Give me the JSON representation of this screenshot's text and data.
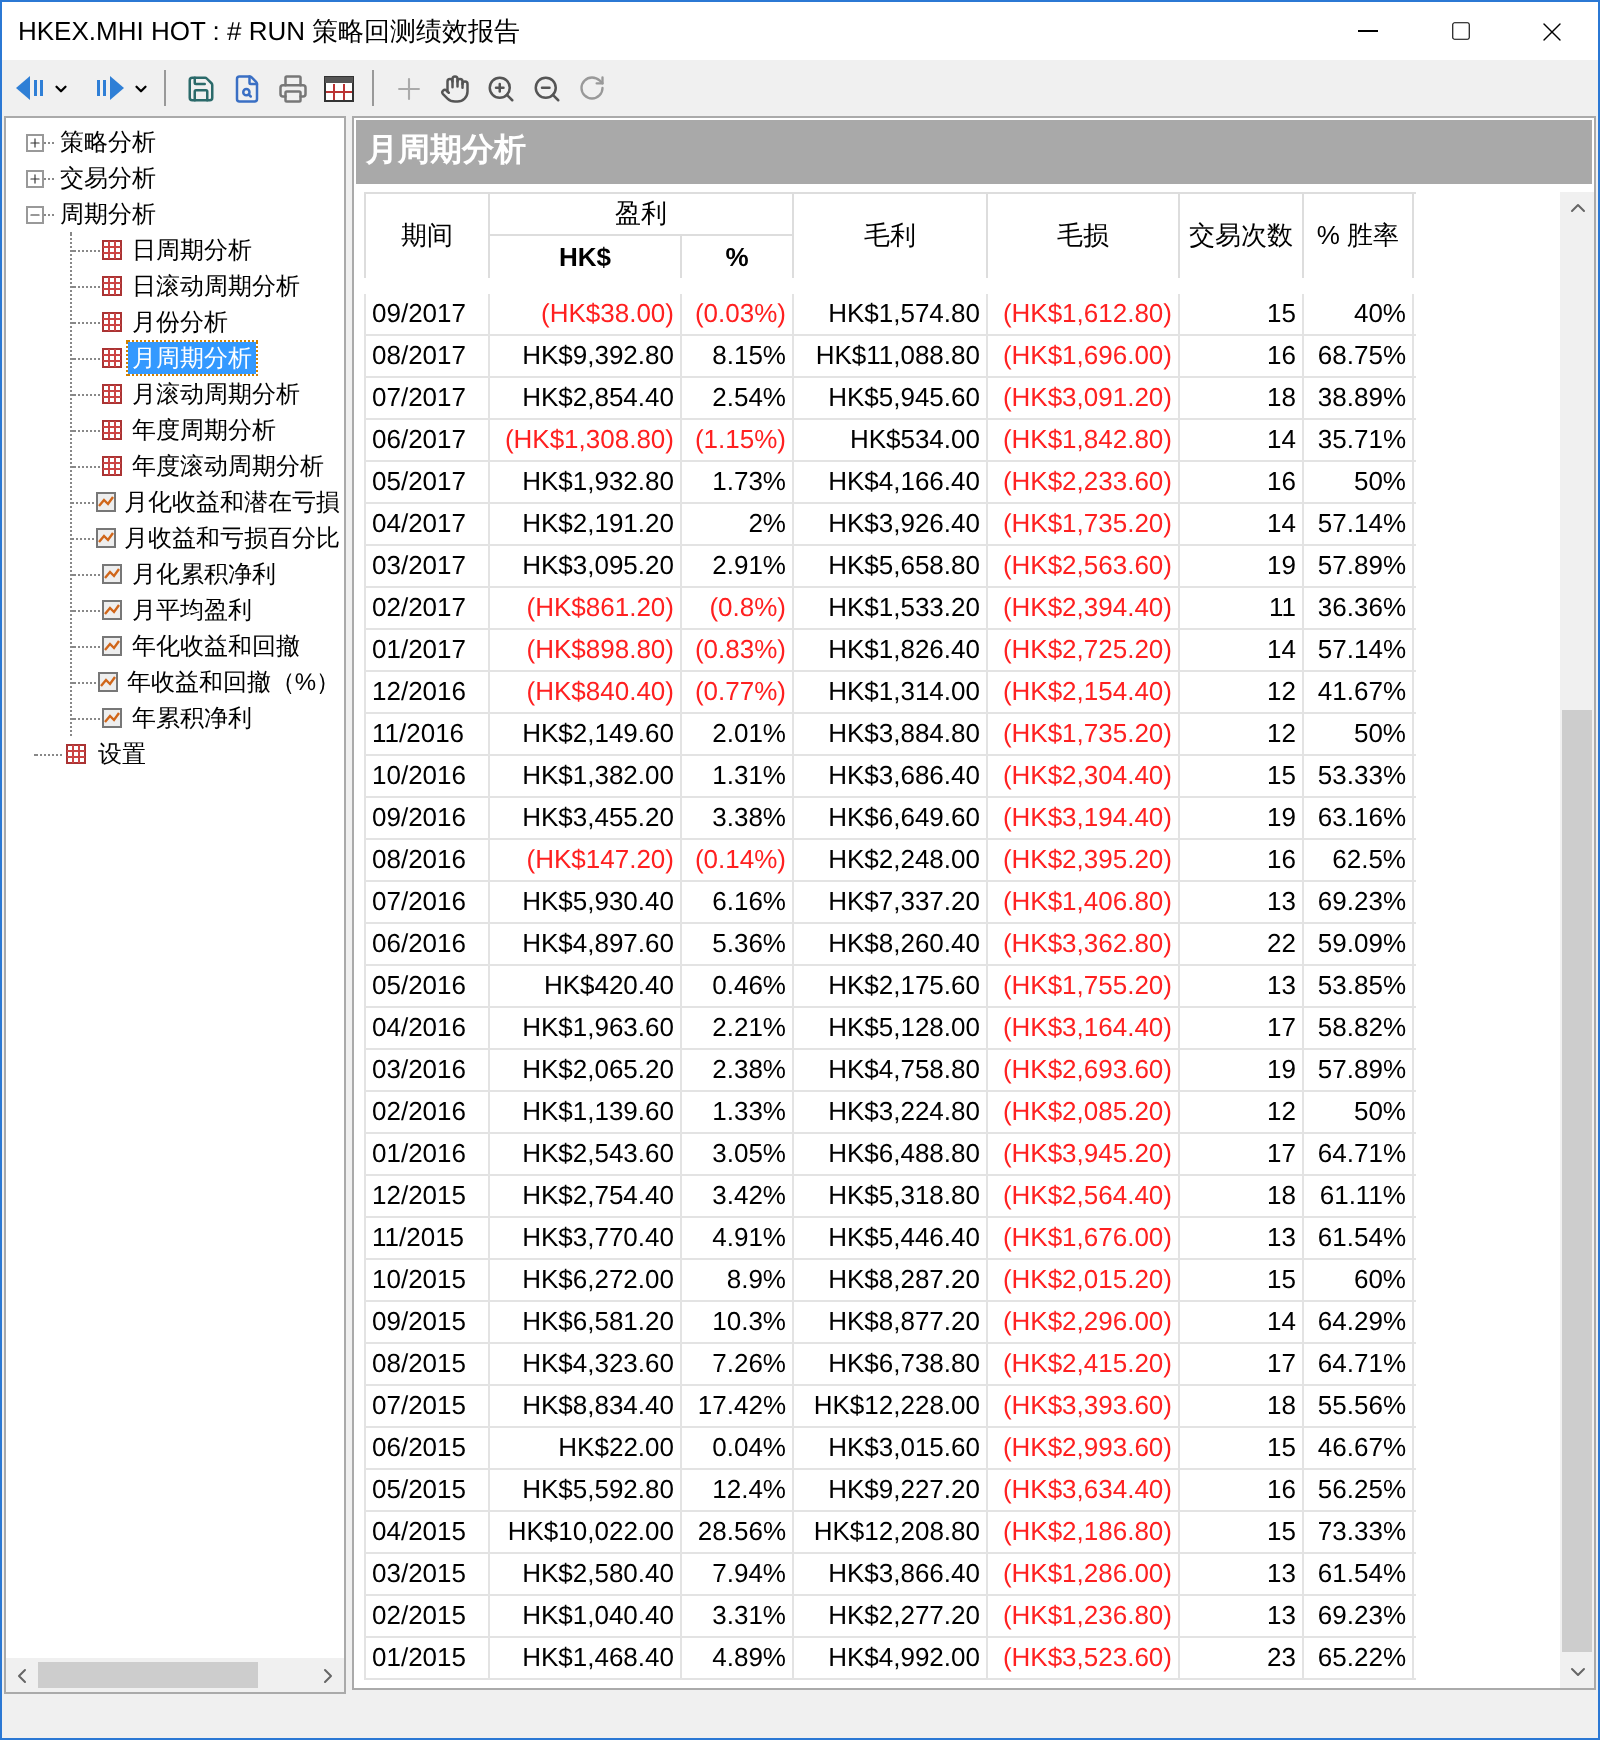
{
  "window": {
    "title": "HKEX.MHI HOT : # RUN 策略回测绩效报告"
  },
  "tree": [
    {
      "label": "策略分析",
      "kind": "folder",
      "expanded": false,
      "selected": false
    },
    {
      "label": "交易分析",
      "kind": "folder",
      "expanded": false,
      "selected": false
    },
    {
      "label": "周期分析",
      "kind": "folder",
      "expanded": true,
      "selected": false,
      "children": [
        {
          "label": "日周期分析",
          "kind": "grid",
          "selected": false
        },
        {
          "label": "日滚动周期分析",
          "kind": "grid",
          "selected": false
        },
        {
          "label": "月份分析",
          "kind": "grid",
          "selected": false
        },
        {
          "label": "月周期分析",
          "kind": "grid",
          "selected": true
        },
        {
          "label": "月滚动周期分析",
          "kind": "grid",
          "selected": false
        },
        {
          "label": "年度周期分析",
          "kind": "grid",
          "selected": false
        },
        {
          "label": "年度滚动周期分析",
          "kind": "grid",
          "selected": false
        },
        {
          "label": "月化收益和潜在亏損",
          "kind": "chart",
          "selected": false
        },
        {
          "label": "月收益和亏损百分比",
          "kind": "chart",
          "selected": false
        },
        {
          "label": "月化累积净利",
          "kind": "chart",
          "selected": false
        },
        {
          "label": "月平均盈利",
          "kind": "chart",
          "selected": false
        },
        {
          "label": "年化收益和回撤",
          "kind": "chart",
          "selected": false
        },
        {
          "label": "年收益和回撤（%）",
          "kind": "chart",
          "selected": false
        },
        {
          "label": "年累积净利",
          "kind": "chart",
          "selected": false
        }
      ]
    },
    {
      "label": "设置",
      "kind": "grid",
      "selected": false
    }
  ],
  "panel": {
    "title": "月周期分析"
  },
  "table": {
    "column_groups": [
      {
        "label": "盈利"
      }
    ],
    "columns": [
      {
        "label": "期间"
      },
      {
        "label": "HK$"
      },
      {
        "label": "%"
      },
      {
        "label": "毛利"
      },
      {
        "label": "毛损"
      },
      {
        "label": "交易次数"
      },
      {
        "label": "% 胜率"
      }
    ],
    "rows": [
      {
        "negative": true,
        "cells": [
          "09/2017",
          "(HK$38.00)",
          "(0.03%)",
          "HK$1,574.80",
          "(HK$1,612.80)",
          "15",
          "40%"
        ]
      },
      {
        "negative": false,
        "cells": [
          "08/2017",
          "HK$9,392.80",
          "8.15%",
          "HK$11,088.80",
          "(HK$1,696.00)",
          "16",
          "68.75%"
        ]
      },
      {
        "negative": false,
        "cells": [
          "07/2017",
          "HK$2,854.40",
          "2.54%",
          "HK$5,945.60",
          "(HK$3,091.20)",
          "18",
          "38.89%"
        ]
      },
      {
        "negative": true,
        "cells": [
          "06/2017",
          "(HK$1,308.80)",
          "(1.15%)",
          "HK$534.00",
          "(HK$1,842.80)",
          "14",
          "35.71%"
        ]
      },
      {
        "negative": false,
        "cells": [
          "05/2017",
          "HK$1,932.80",
          "1.73%",
          "HK$4,166.40",
          "(HK$2,233.60)",
          "16",
          "50%"
        ]
      },
      {
        "negative": false,
        "cells": [
          "04/2017",
          "HK$2,191.20",
          "2%",
          "HK$3,926.40",
          "(HK$1,735.20)",
          "14",
          "57.14%"
        ]
      },
      {
        "negative": false,
        "cells": [
          "03/2017",
          "HK$3,095.20",
          "2.91%",
          "HK$5,658.80",
          "(HK$2,563.60)",
          "19",
          "57.89%"
        ]
      },
      {
        "negative": true,
        "cells": [
          "02/2017",
          "(HK$861.20)",
          "(0.8%)",
          "HK$1,533.20",
          "(HK$2,394.40)",
          "11",
          "36.36%"
        ]
      },
      {
        "negative": true,
        "cells": [
          "01/2017",
          "(HK$898.80)",
          "(0.83%)",
          "HK$1,826.40",
          "(HK$2,725.20)",
          "14",
          "57.14%"
        ]
      },
      {
        "negative": true,
        "cells": [
          "12/2016",
          "(HK$840.40)",
          "(0.77%)",
          "HK$1,314.00",
          "(HK$2,154.40)",
          "12",
          "41.67%"
        ]
      },
      {
        "negative": false,
        "cells": [
          "11/2016",
          "HK$2,149.60",
          "2.01%",
          "HK$3,884.80",
          "(HK$1,735.20)",
          "12",
          "50%"
        ]
      },
      {
        "negative": false,
        "cells": [
          "10/2016",
          "HK$1,382.00",
          "1.31%",
          "HK$3,686.40",
          "(HK$2,304.40)",
          "15",
          "53.33%"
        ]
      },
      {
        "negative": false,
        "cells": [
          "09/2016",
          "HK$3,455.20",
          "3.38%",
          "HK$6,649.60",
          "(HK$3,194.40)",
          "19",
          "63.16%"
        ]
      },
      {
        "negative": true,
        "cells": [
          "08/2016",
          "(HK$147.20)",
          "(0.14%)",
          "HK$2,248.00",
          "(HK$2,395.20)",
          "16",
          "62.5%"
        ]
      },
      {
        "negative": false,
        "cells": [
          "07/2016",
          "HK$5,930.40",
          "6.16%",
          "HK$7,337.20",
          "(HK$1,406.80)",
          "13",
          "69.23%"
        ]
      },
      {
        "negative": false,
        "cells": [
          "06/2016",
          "HK$4,897.60",
          "5.36%",
          "HK$8,260.40",
          "(HK$3,362.80)",
          "22",
          "59.09%"
        ]
      },
      {
        "negative": false,
        "cells": [
          "05/2016",
          "HK$420.40",
          "0.46%",
          "HK$2,175.60",
          "(HK$1,755.20)",
          "13",
          "53.85%"
        ]
      },
      {
        "negative": false,
        "cells": [
          "04/2016",
          "HK$1,963.60",
          "2.21%",
          "HK$5,128.00",
          "(HK$3,164.40)",
          "17",
          "58.82%"
        ]
      },
      {
        "negative": false,
        "cells": [
          "03/2016",
          "HK$2,065.20",
          "2.38%",
          "HK$4,758.80",
          "(HK$2,693.60)",
          "19",
          "57.89%"
        ]
      },
      {
        "negative": false,
        "cells": [
          "02/2016",
          "HK$1,139.60",
          "1.33%",
          "HK$3,224.80",
          "(HK$2,085.20)",
          "12",
          "50%"
        ]
      },
      {
        "negative": false,
        "cells": [
          "01/2016",
          "HK$2,543.60",
          "3.05%",
          "HK$6,488.80",
          "(HK$3,945.20)",
          "17",
          "64.71%"
        ]
      },
      {
        "negative": false,
        "cells": [
          "12/2015",
          "HK$2,754.40",
          "3.42%",
          "HK$5,318.80",
          "(HK$2,564.40)",
          "18",
          "61.11%"
        ]
      },
      {
        "negative": false,
        "cells": [
          "11/2015",
          "HK$3,770.40",
          "4.91%",
          "HK$5,446.40",
          "(HK$1,676.00)",
          "13",
          "61.54%"
        ]
      },
      {
        "negative": false,
        "cells": [
          "10/2015",
          "HK$6,272.00",
          "8.9%",
          "HK$8,287.20",
          "(HK$2,015.20)",
          "15",
          "60%"
        ]
      },
      {
        "negative": false,
        "cells": [
          "09/2015",
          "HK$6,581.20",
          "10.3%",
          "HK$8,877.20",
          "(HK$2,296.00)",
          "14",
          "64.29%"
        ]
      },
      {
        "negative": false,
        "cells": [
          "08/2015",
          "HK$4,323.60",
          "7.26%",
          "HK$6,738.80",
          "(HK$2,415.20)",
          "17",
          "64.71%"
        ]
      },
      {
        "negative": false,
        "cells": [
          "07/2015",
          "HK$8,834.40",
          "17.42%",
          "HK$12,228.00",
          "(HK$3,393.60)",
          "18",
          "55.56%"
        ]
      },
      {
        "negative": false,
        "cells": [
          "06/2015",
          "HK$22.00",
          "0.04%",
          "HK$3,015.60",
          "(HK$2,993.60)",
          "15",
          "46.67%"
        ]
      },
      {
        "negative": false,
        "cells": [
          "05/2015",
          "HK$5,592.80",
          "12.4%",
          "HK$9,227.20",
          "(HK$3,634.40)",
          "16",
          "56.25%"
        ]
      },
      {
        "negative": false,
        "cells": [
          "04/2015",
          "HK$10,022.00",
          "28.56%",
          "HK$12,208.80",
          "(HK$2,186.80)",
          "15",
          "73.33%"
        ]
      },
      {
        "negative": false,
        "cells": [
          "03/2015",
          "HK$2,580.40",
          "7.94%",
          "HK$3,866.40",
          "(HK$1,286.00)",
          "13",
          "61.54%"
        ]
      },
      {
        "negative": false,
        "cells": [
          "02/2015",
          "HK$1,040.40",
          "3.31%",
          "HK$2,277.20",
          "(HK$1,236.80)",
          "13",
          "69.23%"
        ]
      },
      {
        "negative": false,
        "cells": [
          "01/2015",
          "HK$1,468.40",
          "4.89%",
          "HK$4,992.00",
          "(HK$3,523.60)",
          "23",
          "65.22%"
        ]
      }
    ]
  }
}
